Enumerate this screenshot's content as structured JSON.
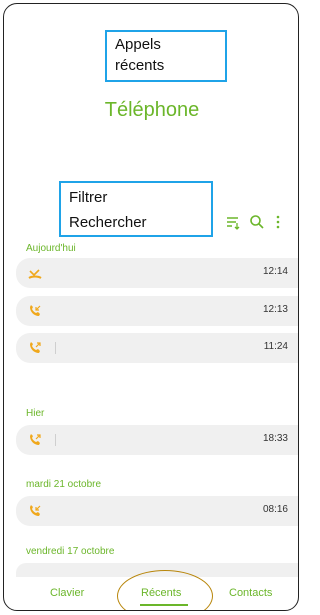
{
  "annotations": {
    "appels_recents": [
      "Appels",
      "récents"
    ],
    "filtrer_rechercher": [
      "Filtrer",
      "Rechercher"
    ]
  },
  "header": {
    "title": "Téléphone"
  },
  "toolbar": {
    "icons": [
      "filter-icon",
      "search-icon",
      "more-vert-icon"
    ]
  },
  "sections": [
    {
      "label": "Aujourd'hui",
      "calls": [
        {
          "type": "missed",
          "time": "12:14"
        },
        {
          "type": "incoming",
          "time": "12:13"
        },
        {
          "type": "outgoing",
          "time": "11:24"
        }
      ]
    },
    {
      "label": "Hier",
      "calls": [
        {
          "type": "outgoing",
          "time": "18:33"
        }
      ]
    },
    {
      "label": "mardi 21 octobre",
      "calls": [
        {
          "type": "incoming",
          "time": "08:16"
        }
      ]
    },
    {
      "label": "vendredi 17 octobre",
      "calls": []
    }
  ],
  "bottom_nav": {
    "tabs": [
      "Clavier",
      "Récents",
      "Contacts"
    ],
    "active": "Récents"
  },
  "colors": {
    "accent": "#6bb62a",
    "call_icon": "#f0a81c",
    "missed_icon": "#f0a81c",
    "callout_border": "#1fa3e8",
    "circle": "#b8860b"
  }
}
